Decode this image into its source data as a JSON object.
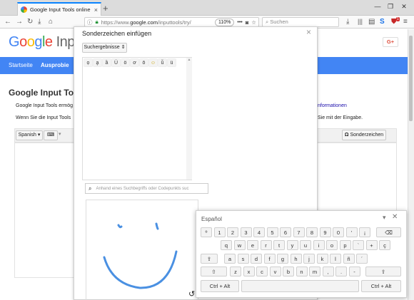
{
  "browser": {
    "tab_title": "Google Input Tools online testen",
    "tab_close": "×",
    "new_tab": "+",
    "window_buttons": [
      "—",
      "❐",
      "✕"
    ],
    "url_prefix": "https://www.",
    "url_domain": "google.com",
    "url_path": "/inputtools/try/",
    "zoom": "110%",
    "more_actions": "•••",
    "search_placeholder": "Suchen",
    "notification_count": "1"
  },
  "page": {
    "logo_letters": [
      "G",
      "o",
      "o",
      "g",
      "l",
      "e"
    ],
    "logo_suffix": "Inpu",
    "nav_home": "Startseite",
    "nav_try": "Ausprobie",
    "heading": "Google Input Too",
    "para1_start": "Google Input Tools ermög",
    "para1_end": "nformationen",
    "para2_start": "Wenn Sie die Input Tools",
    "para2_end": "Sie mit der Eingabe.",
    "language_select": "Spanish",
    "special_chars_button": "Sonderzeichen",
    "gplus": "G+"
  },
  "dialog": {
    "title": "Sonderzeichen einfügen",
    "close": "×",
    "results_label": "Suchergebnisse",
    "chars": [
      "ọ",
      "ḁ",
      "ȁ",
      "Ü",
      "ö",
      "ơ",
      "ō",
      "☺",
      "ǚ",
      "ü"
    ],
    "search_placeholder": "Anhand eines Suchbegriffs oder Codepunkts suc"
  },
  "keyboard": {
    "title": "Español",
    "rows": [
      [
        "º",
        "1",
        "2",
        "3",
        "4",
        "5",
        "6",
        "7",
        "8",
        "9",
        "0",
        "'",
        "¡"
      ],
      [
        "q",
        "w",
        "e",
        "r",
        "t",
        "y",
        "u",
        "i",
        "o",
        "p",
        "`",
        "+",
        "ç"
      ],
      [
        "a",
        "s",
        "d",
        "f",
        "g",
        "h",
        "j",
        "k",
        "l",
        "ñ",
        "´"
      ],
      [
        "z",
        "x",
        "c",
        "v",
        "b",
        "n",
        "m",
        ",",
        ".",
        "-"
      ]
    ],
    "ctrl_alt_left": "Ctrl + Alt",
    "ctrl_alt_right": "Ctrl + Alt"
  },
  "colors": {
    "brand_blue": "#4285f4",
    "drawing_stroke": "#4a90e2",
    "accent_tab": "#0a84ff"
  }
}
